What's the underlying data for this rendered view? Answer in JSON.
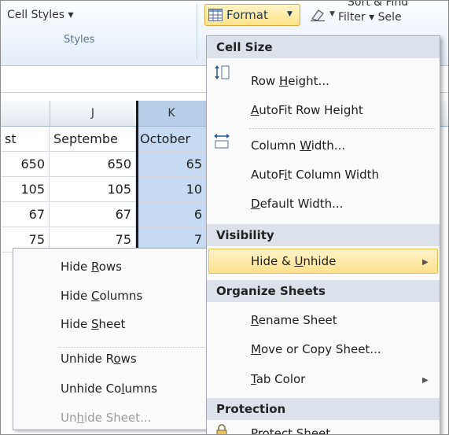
{
  "ribbon": {
    "cell_styles": "Cell Styles ▾",
    "styles_group": "Styles",
    "format_label": "Format",
    "sort_top": "Sort & Find",
    "sort_filter": "Filter ▾ Sele",
    "accent": "#ffe38a"
  },
  "columns": {
    "j": "J",
    "k": "K"
  },
  "grid": {
    "header_row": [
      "st",
      "Septembe",
      "October"
    ],
    "rows": [
      [
        "650",
        "650",
        "65"
      ],
      [
        "105",
        "105",
        "10"
      ],
      [
        "67",
        "67",
        "6"
      ],
      [
        "75",
        "75",
        "7"
      ]
    ]
  },
  "submenu": {
    "items": [
      {
        "pre": "Hide ",
        "ul": "R",
        "post": "ows"
      },
      {
        "pre": "Hide ",
        "ul": "C",
        "post": "olumns"
      },
      {
        "pre": "Hide ",
        "ul": "S",
        "post": "heet"
      },
      {
        "pre": "Unhide R",
        "ul": "o",
        "post": "ws"
      },
      {
        "pre": "Unhide Co",
        "ul": "l",
        "post": "umns"
      },
      {
        "pre": "Un",
        "ul": "h",
        "post": "ide Sheet..."
      }
    ]
  },
  "menu": {
    "cell_size_header": "Cell Size",
    "row_height": {
      "pre": "Row ",
      "ul": "H",
      "post": "eight..."
    },
    "autofit_row": {
      "pre": "",
      "ul": "A",
      "post": "utoFit Row Height"
    },
    "column_width": {
      "pre": "Column ",
      "ul": "W",
      "post": "idth..."
    },
    "autofit_col": {
      "pre": "AutoF",
      "ul": "i",
      "post": "t Column Width"
    },
    "default_width": {
      "pre": "",
      "ul": "D",
      "post": "efault Width..."
    },
    "visibility_header": "Visibility",
    "hide_unhide": {
      "pre": "Hide & ",
      "ul": "U",
      "post": "nhide"
    },
    "organize_header": "Organize Sheets",
    "rename": {
      "pre": "",
      "ul": "R",
      "post": "ename Sheet"
    },
    "move_copy": {
      "pre": "",
      "ul": "M",
      "post": "ove or Copy Sheet..."
    },
    "tab_color": {
      "pre": "",
      "ul": "T",
      "post": "ab Color"
    },
    "protection_header": "Protection",
    "protect_sheet": "Protect Sheet..."
  }
}
